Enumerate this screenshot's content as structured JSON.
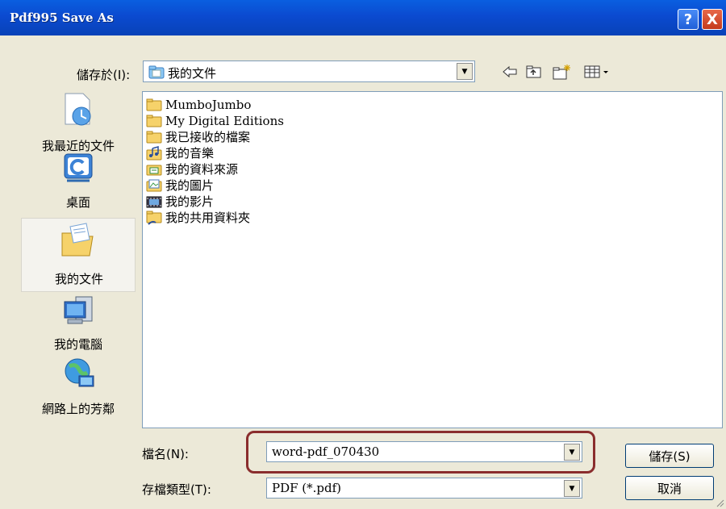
{
  "window": {
    "title": "Pdf995 Save As",
    "help_label": "?",
    "close_label": "X"
  },
  "look_in": {
    "label": "儲存於(I):",
    "value": "我的文件"
  },
  "places": [
    {
      "label": "我最近的文件",
      "icon": "recent-docs-icon"
    },
    {
      "label": "桌面",
      "icon": "desktop-icon"
    },
    {
      "label": "我的文件",
      "icon": "my-documents-icon"
    },
    {
      "label": "我的電腦",
      "icon": "my-computer-icon"
    },
    {
      "label": "網路上的芳鄰",
      "icon": "network-places-icon"
    }
  ],
  "files": [
    {
      "name": "MumboJumbo",
      "icon": "folder-icon"
    },
    {
      "name": "My Digital Editions",
      "icon": "folder-icon"
    },
    {
      "name": "我已接收的檔案",
      "icon": "folder-icon"
    },
    {
      "name": "我的音樂",
      "icon": "music-folder-icon"
    },
    {
      "name": "我的資料來源",
      "icon": "data-sources-folder-icon"
    },
    {
      "name": "我的圖片",
      "icon": "pictures-folder-icon"
    },
    {
      "name": "我的影片",
      "icon": "videos-folder-icon"
    },
    {
      "name": "我的共用資料夾",
      "icon": "shared-folder-icon"
    }
  ],
  "filename": {
    "label": "檔名(N):",
    "value": "word-pdf_070430"
  },
  "filetype": {
    "label": "存檔類型(T):",
    "value": "PDF (*.pdf)"
  },
  "buttons": {
    "save": "儲存(S)",
    "cancel": "取消"
  },
  "colors": {
    "titlebar": "#0b4ad0",
    "highlight": "#8a2d2d",
    "dialog_bg": "#ece9d8"
  }
}
